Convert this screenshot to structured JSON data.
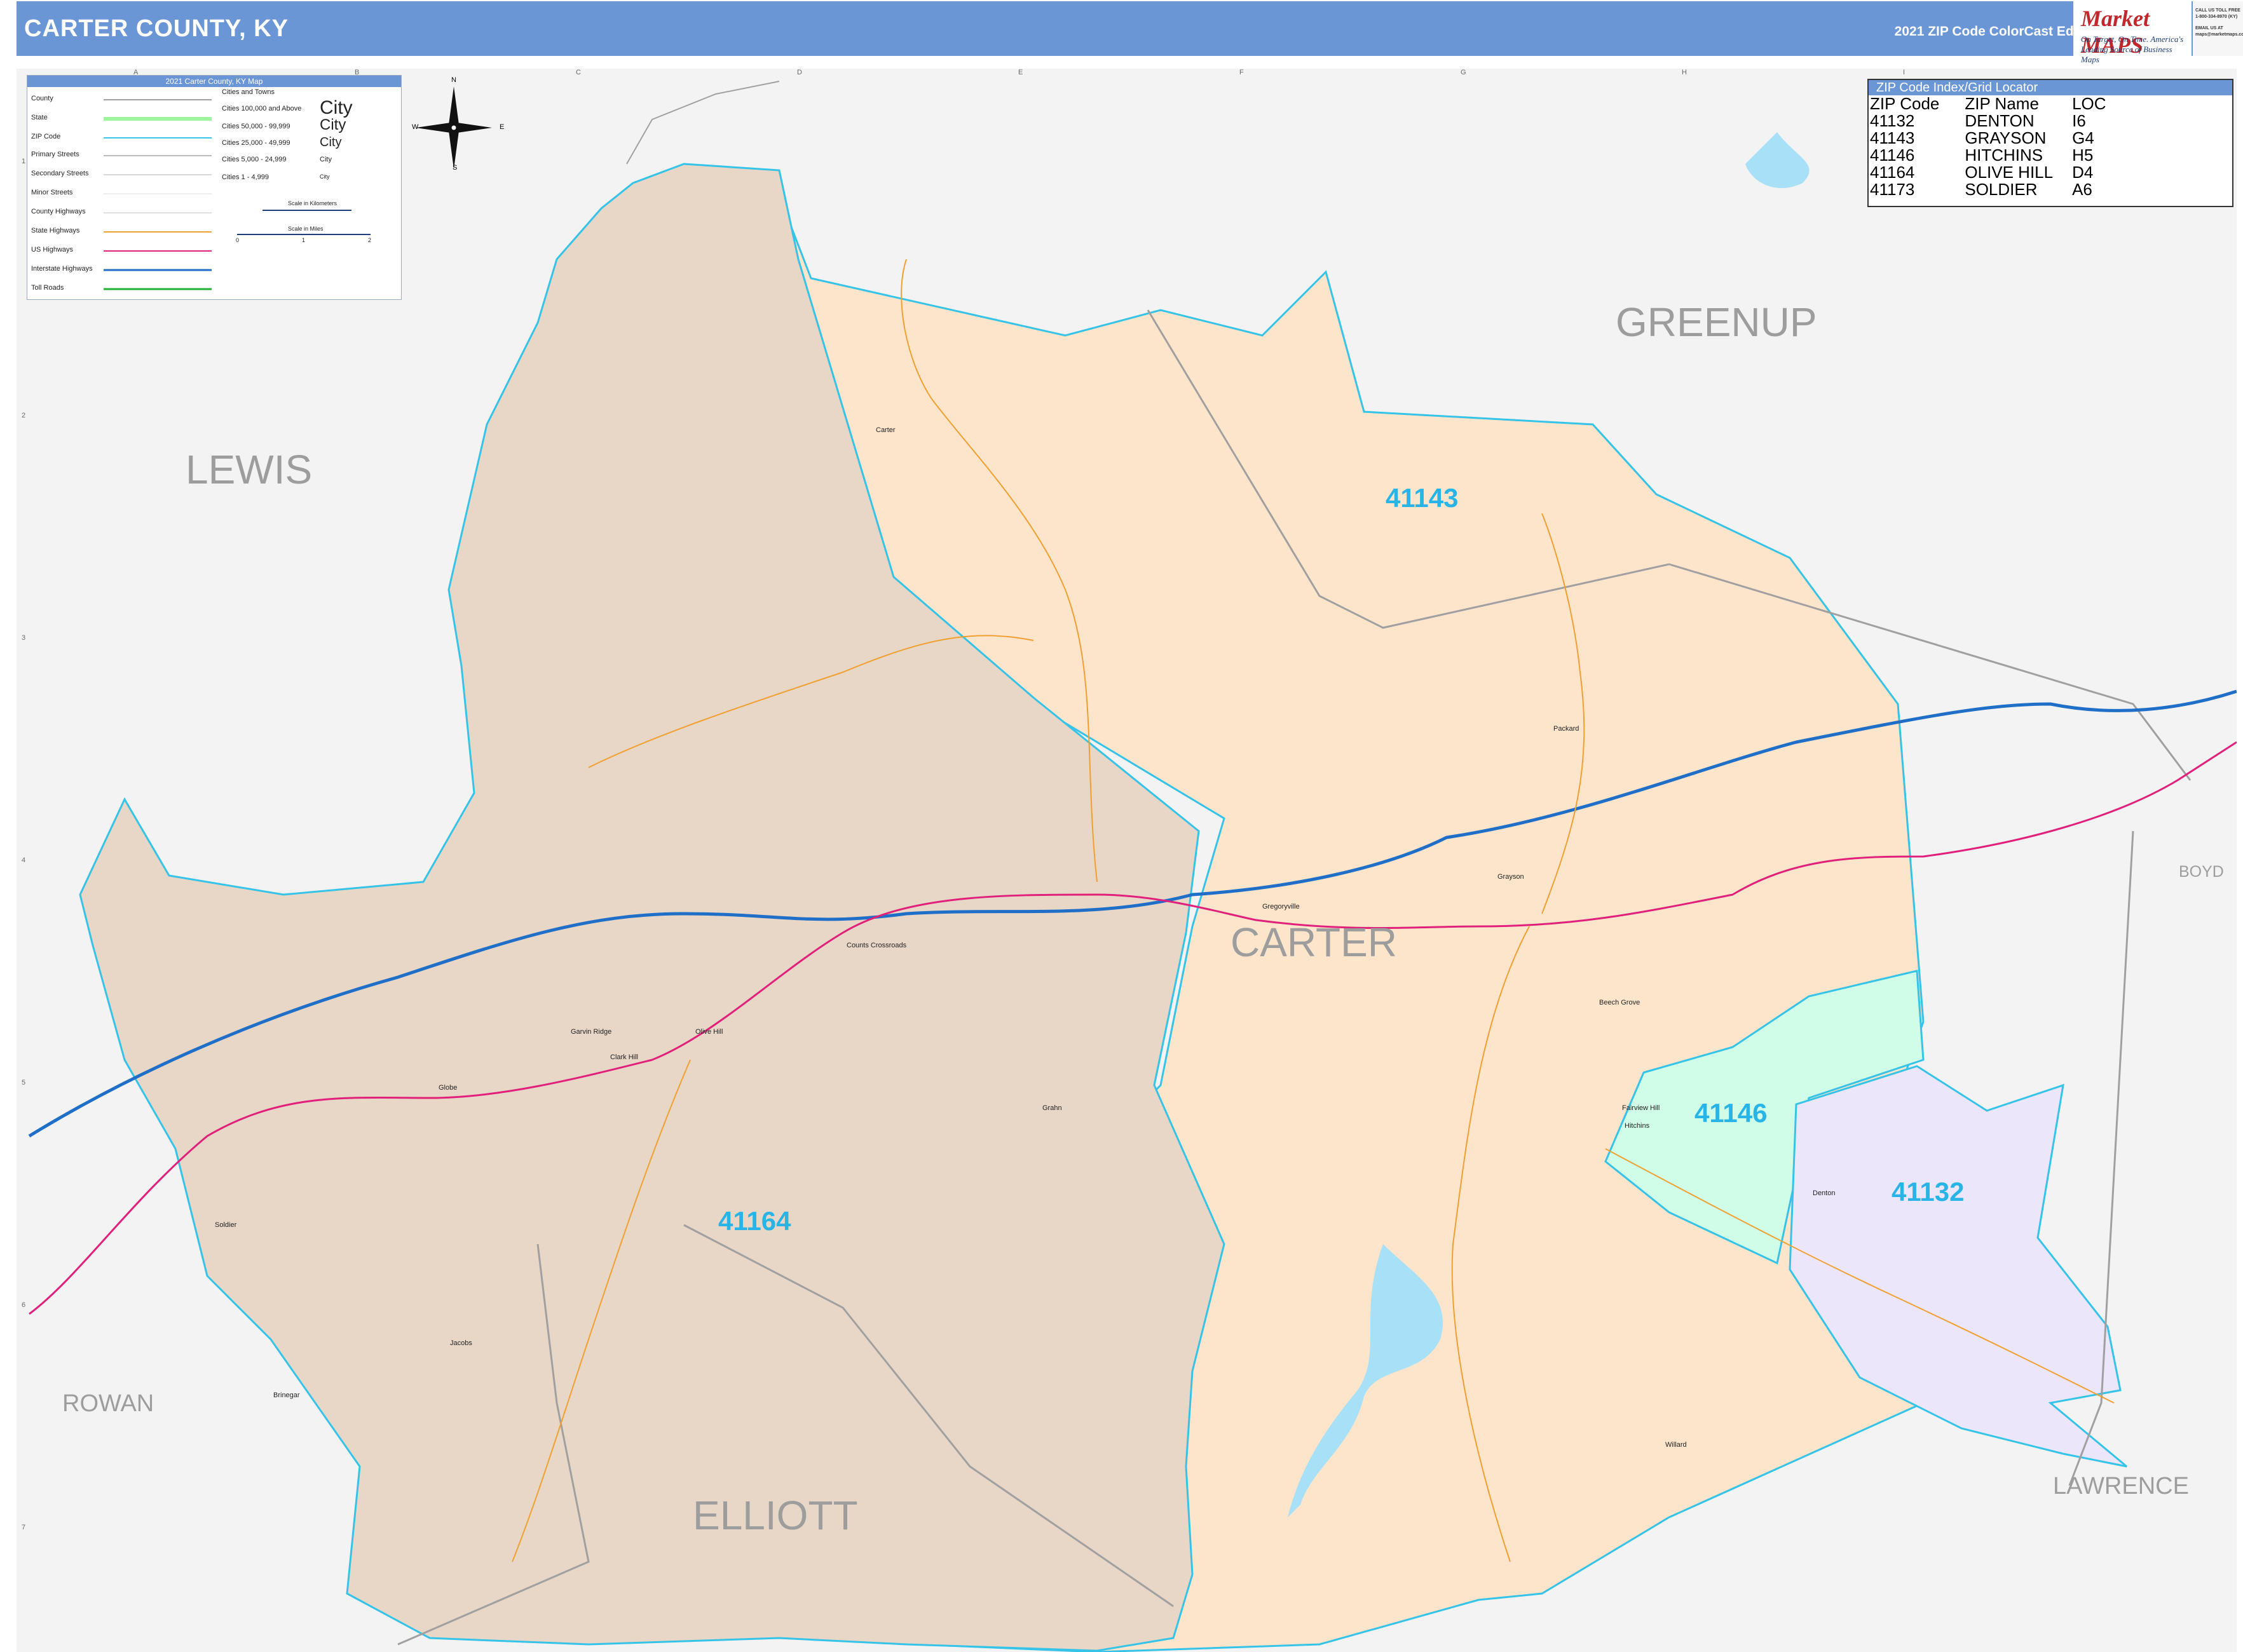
{
  "header": {
    "title": "CARTER COUNTY, KY",
    "edition": "2021 ZIP Code ColorCast Edition",
    "brand_name": "Market MAPS",
    "brand_tagline": "On Target, On Time. America's Leading Source of Business Maps",
    "contact_lines": [
      "CALL US TOLL FREE",
      "1-800-334-8970 (KY)",
      "EMAIL US AT",
      "maps@marketmaps.com"
    ]
  },
  "legend": {
    "title": "2021 Carter County, KY Map",
    "items": [
      "County",
      "State",
      "ZIP Code",
      "Primary Streets",
      "Secondary Streets",
      "Minor Streets",
      "County Highways",
      "State Highways",
      "US Highways",
      "Interstate Highways",
      "Toll Roads"
    ],
    "cities_heading": "Cities and Towns",
    "city_sizes": [
      {
        "range": "Cities 100,000 and Above",
        "sample": "City"
      },
      {
        "range": "Cities 50,000 - 99,999",
        "sample": "City"
      },
      {
        "range": "Cities 25,000 - 49,999",
        "sample": "City"
      },
      {
        "range": "Cities 5,000 - 24,999",
        "sample": "City"
      },
      {
        "range": "Cities 1 - 4,999",
        "sample": "City"
      }
    ],
    "scale_km": "Scale in Kilometers",
    "scale_mi": "Scale in Miles",
    "scale_ticks": [
      "0",
      "1",
      "2"
    ],
    "colors": {
      "county": "#a0a0a0",
      "state": "#9ef59e",
      "zip": "#35c3e8",
      "state_hwy": "#f0a030",
      "us_hwy": "#e0207a",
      "interstate": "#1f6fc8",
      "toll": "#21b02f"
    }
  },
  "compass": {
    "n": "N",
    "s": "S",
    "e": "E",
    "w": "W"
  },
  "zip_index": {
    "title": "ZIP Code Index/Grid Locator",
    "columns": [
      "ZIP Code",
      "ZIP Name",
      "LOC"
    ],
    "rows": [
      [
        "41132",
        "DENTON",
        "I6"
      ],
      [
        "41143",
        "GRAYSON",
        "G4"
      ],
      [
        "41146",
        "HITCHINS",
        "H5"
      ],
      [
        "41164",
        "OLIVE HILL",
        "D4"
      ],
      [
        "41173",
        "SOLDIER",
        "A6"
      ]
    ]
  },
  "counties": {
    "lewis": "LEWIS",
    "greenup": "GREENUP",
    "carter": "CARTER",
    "boyd": "BOYD",
    "rowan": "ROWAN",
    "elliott": "ELLIOTT",
    "lawrence": "LAWRENCE"
  },
  "zip_labels": {
    "z41143": "41143",
    "z41164": "41164",
    "z41146": "41146",
    "z41132": "41132"
  },
  "zip_colors": {
    "41164": "#e8d7c6",
    "41143": "#fde5cc",
    "41146": "#cffde7",
    "41132": "#ece6fb"
  },
  "towns": {
    "carter": "Carter",
    "packard": "Packard",
    "grayson": "Grayson",
    "gregoryville": "Gregoryville",
    "counts_crossroads": "Counts Crossroads",
    "garvin_ridge": "Garvin Ridge",
    "olive_hill": "Olive Hill",
    "clark_hill": "Clark Hill",
    "globe": "Globe",
    "grahn": "Grahn",
    "beech_grove": "Beech Grove",
    "fairview_hill": "Fairview Hill",
    "hitchins": "Hitchins",
    "denton": "Denton",
    "soldier": "Soldier",
    "jacobs": "Jacobs",
    "brinegar": "Brinegar",
    "willard": "Willard"
  },
  "grid": {
    "columns": [
      "A",
      "B",
      "C",
      "D",
      "E",
      "F",
      "G",
      "H",
      "I"
    ],
    "rows": [
      "1",
      "2",
      "3",
      "4",
      "5",
      "6",
      "7"
    ]
  }
}
